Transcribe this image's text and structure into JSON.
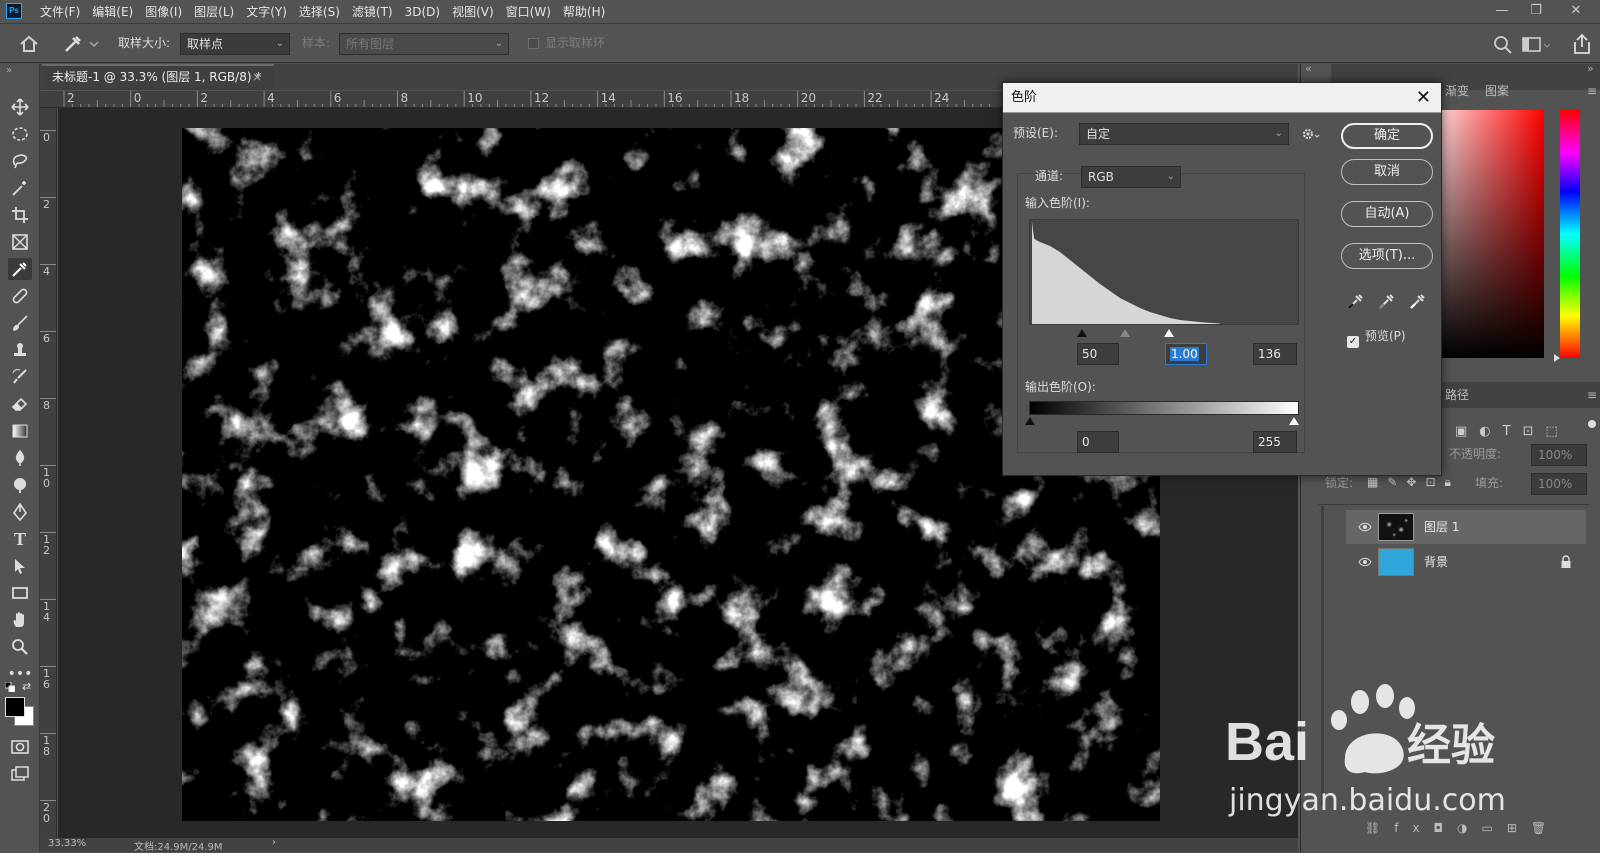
{
  "app": {
    "logo_text": "Ps"
  },
  "menu": [
    "文件(F)",
    "编辑(E)",
    "图像(I)",
    "图层(L)",
    "文字(Y)",
    "选择(S)",
    "滤镜(T)",
    "3D(D)",
    "视图(V)",
    "窗口(W)",
    "帮助(H)"
  ],
  "window_controls": {
    "minimize": "—",
    "restore": "❐",
    "close": "✕"
  },
  "options": {
    "sample_size_label": "取样大小:",
    "sample_size_value": "取样点",
    "sample_label": "样本:",
    "sample_value": "所有图层",
    "show_ring_label": "显示取样环"
  },
  "document": {
    "tab_title": "未标题-1 @ 33.3% (图层 1, RGB/8) *",
    "tab_close": "×"
  },
  "ruler": {
    "h_ticks": [
      "2",
      "0",
      "2",
      "4",
      "6",
      "8",
      "10",
      "12",
      "14",
      "16",
      "18",
      "20",
      "22",
      "24"
    ],
    "v_ticks": [
      "0",
      "2",
      "4",
      "6",
      "8",
      "1\n0",
      "1\n2",
      "1\n4",
      "1\n6",
      "1\n8",
      "2\n0"
    ]
  },
  "status": {
    "zoom": "33.33%",
    "doc_info": "文档:24.9M/24.9M",
    "arrow": "›"
  },
  "panels": {
    "top_tabs": [
      "渐变",
      "图案"
    ],
    "mid_tab": "路径",
    "opacity_label": "不透明度:",
    "opacity_value": "100%",
    "lock_label": "锁定:",
    "fill_label": "填充:",
    "fill_value": "100%",
    "layers": [
      {
        "name": "图层 1",
        "thumb_color": "#111111",
        "locked": false
      },
      {
        "name": "背景",
        "thumb_color": "#2fa6d9",
        "locked": true
      }
    ],
    "collapse_left": "«",
    "collapse_right": "»"
  },
  "levels_dialog": {
    "title": "色阶",
    "close": "✕",
    "preset_label": "预设(E):",
    "preset_value": "自定",
    "channel_label": "通道:",
    "channel_value": "RGB",
    "input_label": "输入色阶(I):",
    "input_black": "50",
    "input_gamma": "1.00",
    "input_white": "136",
    "output_label": "输出色阶(O):",
    "output_black": "0",
    "output_white": "255",
    "buttons": {
      "ok": "确定",
      "cancel": "取消",
      "auto": "自动(A)",
      "options": "选项(T)..."
    },
    "preview_label": "预览(P)",
    "preview_checked": true
  },
  "watermark": {
    "brand": "Bai",
    "brand2": "经验",
    "url": "jingyan.baidu.com"
  }
}
